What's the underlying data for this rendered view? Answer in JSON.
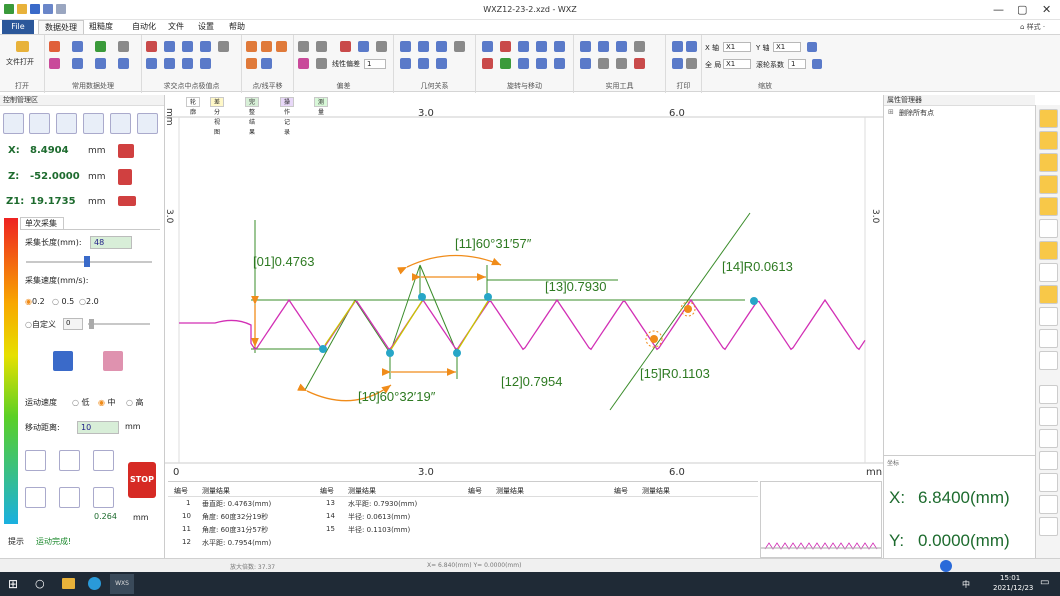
{
  "window": {
    "title": "WXZ12-23-2.xzd - WXZ",
    "minimize": "—",
    "restore": "▢",
    "close": "✕",
    "style_label": "⌂ 样式 ·"
  },
  "menu": [
    "File",
    "数据处理",
    "粗糙度",
    "自动化",
    "文件",
    "设置",
    "帮助"
  ],
  "ribbon": {
    "groups": [
      "打开",
      "常用数据处理",
      "求交点中点极值点",
      "点/线平移",
      "偏差",
      "几何关系",
      "旋转与移动",
      "实用工具",
      "打印",
      "缩放"
    ],
    "open_label": "文件打开",
    "linear_deviation": "线性偏差",
    "linear_deviation_value": "1",
    "x_axis": "X 轴",
    "x_axis_value": "X1",
    "y_axis": "Y 轴",
    "y_axis_value": "X1",
    "global": "全 局",
    "global_value": "X1",
    "roll_factor": "滚轮系数",
    "roll_factor_value": "1"
  },
  "left": {
    "header": "控制管理区",
    "x_label": "X:",
    "x_value": "8.4904",
    "x_unit": "mm",
    "z_label": "Z:",
    "z_value": "-52.0000",
    "z_unit": "mm",
    "z1_label": "Z1:",
    "z1_value": "19.1735",
    "z1_unit": "mm",
    "tab": "单次采集",
    "length_label": "采集长度(mm):",
    "length_value": "48",
    "speed_label": "采集速度(mm/s):",
    "speed_options": [
      "0.2",
      "0.5",
      "2.0"
    ],
    "custom_label": "自定义",
    "custom_value": "0",
    "move_speed_label": "运动速度",
    "move_speed_options": [
      "低",
      "中",
      "高"
    ],
    "move_dist_label": "移动距离:",
    "move_dist_value": "10",
    "move_dist_unit": "mm",
    "stop": "STOP",
    "step_value": "0.264",
    "step_unit": "mm",
    "hint_label": "提示",
    "hint_value": "运动完成!"
  },
  "canvas": {
    "tabs": [
      "轮廓",
      "差分视图",
      "完整结果",
      "操作记录",
      "测量"
    ],
    "unit": "mm",
    "top_ticks": [
      "3.0",
      "6.0"
    ],
    "bottom_ticks": [
      "0",
      "3.0",
      "6.0"
    ],
    "left_tick": "3.0",
    "right_tick": "3.0",
    "bottom_unit": "mn",
    "annotations": {
      "a01": "[01]0.4763",
      "a10": "[10]60°32′19″",
      "a11": "[11]60°31′57″",
      "a12": "[12]0.7954",
      "a13": "[13]0.7930",
      "a14": "[14]R0.0613",
      "a15": "[15]R0.1103"
    }
  },
  "results": {
    "headers": [
      "编号",
      "测量结果",
      "编号",
      "测量结果",
      "编号",
      "测量结果",
      "编号",
      "测量结果"
    ],
    "col1": [
      {
        "id": "1",
        "text": "垂直距: 0.4763(mm)"
      },
      {
        "id": "10",
        "text": "角度: 60度32分19秒"
      },
      {
        "id": "11",
        "text": "角度: 60度31分57秒"
      },
      {
        "id": "12",
        "text": "水平距: 0.7954(mm)"
      }
    ],
    "col2": [
      {
        "id": "13",
        "text": "水平距: 0.7930(mm)"
      },
      {
        "id": "14",
        "text": "半径: 0.0613(mm)"
      },
      {
        "id": "15",
        "text": "半径: 0.1103(mm)"
      }
    ]
  },
  "right": {
    "header": "属性管理器",
    "item": "删除所有点",
    "coord_title": "坐标",
    "x_label": "X:",
    "x_value": "6.8400(mm)",
    "y_label": "Y:",
    "y_value": "0.0000(mm)"
  },
  "status": {
    "zoom": "放大倍数: 37.37",
    "xy": "X= 6.840(mm)  Y= 0.0000(mm)"
  },
  "taskbar": {
    "app": "WXS",
    "time": "15:01",
    "date": "2021/12/23",
    "ime": "中"
  },
  "colors": {
    "profile": "#d22fb5",
    "measure": "#3a8c2a",
    "point_cyan": "#27a6c7",
    "point_orange": "#f08c1a",
    "arrow": "#f08c1a",
    "ribbon_blue": "#2b579a",
    "green_text": "#1d6b2e"
  }
}
